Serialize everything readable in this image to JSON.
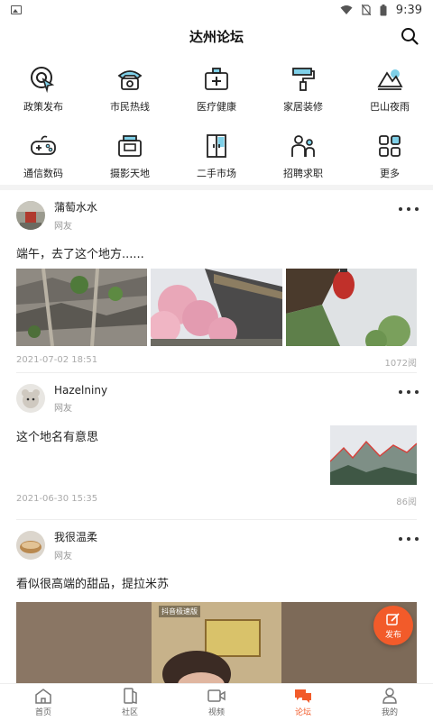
{
  "status_bar": {
    "time": "9:39"
  },
  "header": {
    "title": "达州论坛"
  },
  "categories": [
    {
      "label": "政策发布",
      "icon": "policy-icon"
    },
    {
      "label": "市民热线",
      "icon": "telephone-icon"
    },
    {
      "label": "医疗健康",
      "icon": "medical-kit-icon"
    },
    {
      "label": "家居装修",
      "icon": "paint-roller-icon"
    },
    {
      "label": "巴山夜雨",
      "icon": "mountain-icon"
    },
    {
      "label": "通信数码",
      "icon": "gamepad-icon"
    },
    {
      "label": "摄影天地",
      "icon": "camera-icon"
    },
    {
      "label": "二手市场",
      "icon": "wardrobe-icon"
    },
    {
      "label": "招聘求职",
      "icon": "people-icon"
    },
    {
      "label": "更多",
      "icon": "grid-icon"
    }
  ],
  "posts": [
    {
      "user": "蒲萄水水",
      "role": "网友",
      "text": "端午，去了这个地方......",
      "date": "2021-07-02 18:51",
      "views": "1072阅"
    },
    {
      "user": "Hazelniny",
      "role": "网友",
      "text": "这个地名有意思",
      "date": "2021-06-30 15:35",
      "views": "86阅"
    },
    {
      "user": "我很温柔",
      "role": "网友",
      "text": "看似很高端的甜品，提拉米苏",
      "video_badge": "抖音极速版"
    }
  ],
  "fab": {
    "label": "发布"
  },
  "bottom_nav": [
    {
      "label": "首页",
      "icon": "home-icon"
    },
    {
      "label": "社区",
      "icon": "community-icon"
    },
    {
      "label": "视频",
      "icon": "video-icon"
    },
    {
      "label": "论坛",
      "icon": "forum-icon",
      "active": true
    },
    {
      "label": "我的",
      "icon": "profile-icon"
    }
  ],
  "colors": {
    "accent": "#f25b2a",
    "icon_highlight": "#7fd0e8"
  }
}
